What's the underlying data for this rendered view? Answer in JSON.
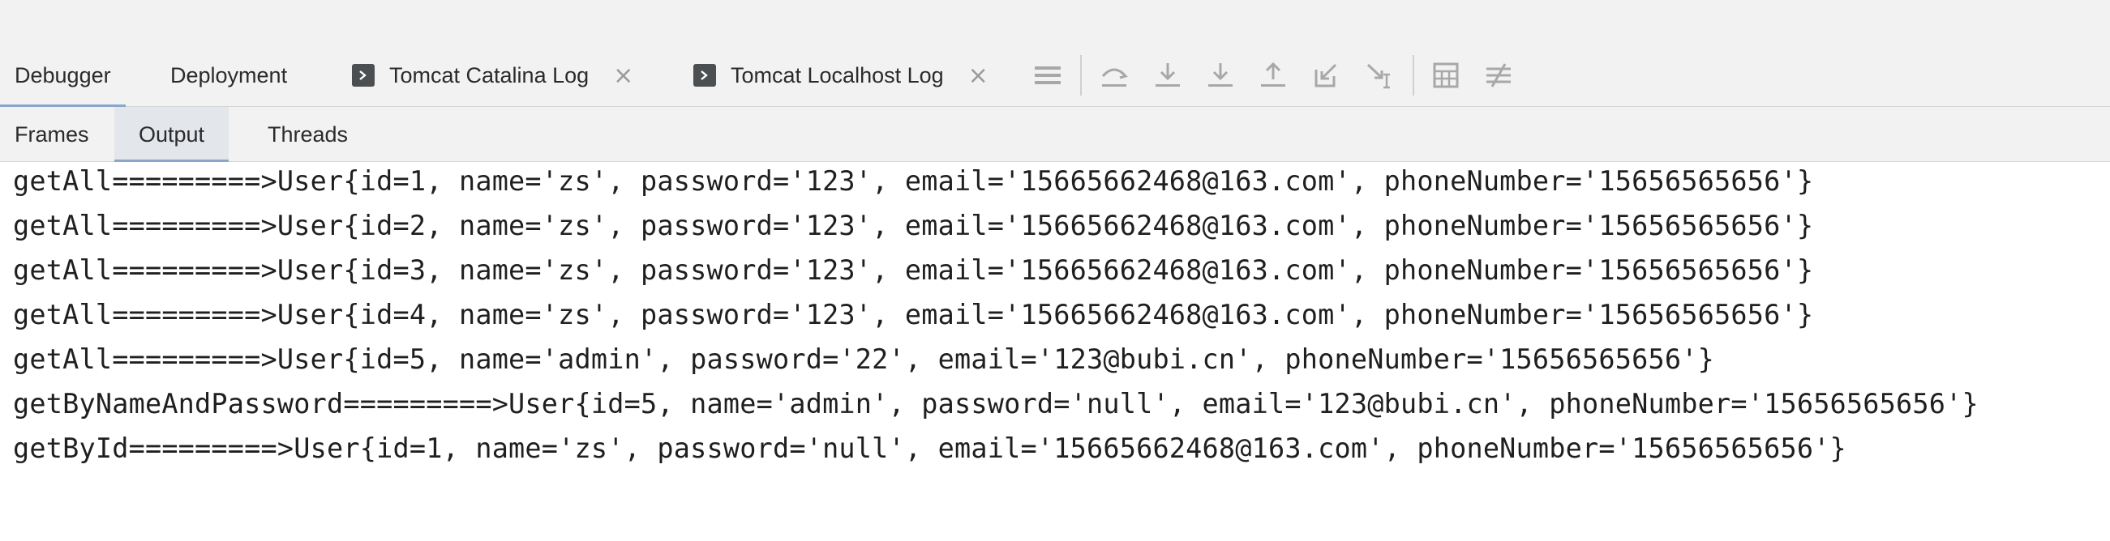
{
  "toolbar": {
    "tabs": [
      {
        "label": "Debugger"
      },
      {
        "label": "Deployment"
      },
      {
        "label": "Tomcat Catalina Log",
        "icon": "terminal-icon"
      },
      {
        "label": "Tomcat Localhost Log",
        "icon": "terminal-icon"
      }
    ],
    "close_glyph": "×",
    "icons": [
      "menu-icon",
      "show-execution-point-icon",
      "step-over-icon",
      "step-into-icon",
      "step-out-icon",
      "drop-frame-icon",
      "run-to-cursor-icon",
      "evaluate-expression-icon",
      "trace-settings-icon"
    ]
  },
  "subtabs": [
    {
      "label": "Frames"
    },
    {
      "label": "Output"
    },
    {
      "label": "Threads"
    }
  ],
  "console": {
    "lines": [
      "getAll=========>User{id=1, name='zs', password='123', email='15665662468@163.com', phoneNumber='15656565656'}",
      "getAll=========>User{id=2, name='zs', password='123', email='15665662468@163.com', phoneNumber='15656565656'}",
      "getAll=========>User{id=3, name='zs', password='123', email='15665662468@163.com', phoneNumber='15656565656'}",
      "getAll=========>User{id=4, name='zs', password='123', email='15665662468@163.com', phoneNumber='15656565656'}",
      "getAll=========>User{id=5, name='admin', password='22', email='123@bubi.cn', phoneNumber='15656565656'}",
      "getByNameAndPassword=========>User{id=5, name='admin', password='null', email='123@bubi.cn', phoneNumber='15656565656'}",
      "getById=========>User{id=1, name='zs', password='null', email='15665662468@163.com', phoneNumber='15656565656'}"
    ]
  },
  "colors": {
    "accent": "#8aa6c9",
    "toolbar_bg": "#f2f2f2",
    "icon_gray": "#a8a8a8",
    "text": "#1f1f1f"
  }
}
